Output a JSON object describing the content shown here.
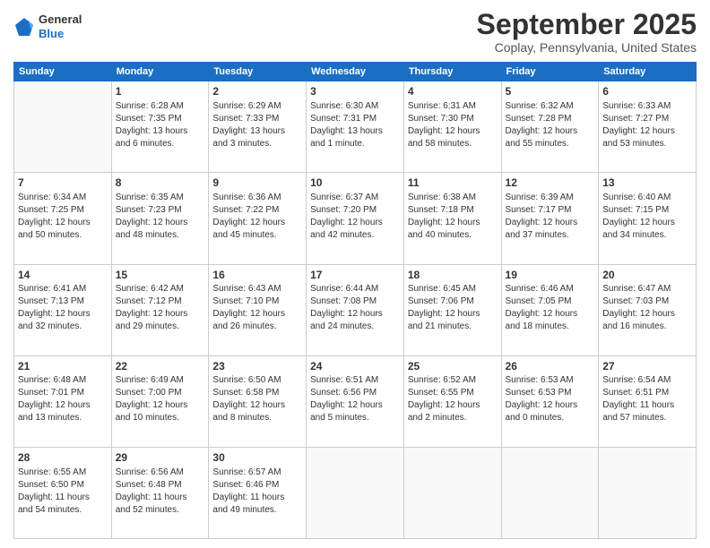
{
  "header": {
    "logo": {
      "general": "General",
      "blue": "Blue"
    },
    "title": "September 2025",
    "location": "Coplay, Pennsylvania, United States"
  },
  "calendar": {
    "headers": [
      "Sunday",
      "Monday",
      "Tuesday",
      "Wednesday",
      "Thursday",
      "Friday",
      "Saturday"
    ],
    "weeks": [
      [
        {
          "day": "",
          "data": ""
        },
        {
          "day": "1",
          "data": "Sunrise: 6:28 AM\nSunset: 7:35 PM\nDaylight: 13 hours\nand 6 minutes."
        },
        {
          "day": "2",
          "data": "Sunrise: 6:29 AM\nSunset: 7:33 PM\nDaylight: 13 hours\nand 3 minutes."
        },
        {
          "day": "3",
          "data": "Sunrise: 6:30 AM\nSunset: 7:31 PM\nDaylight: 13 hours\nand 1 minute."
        },
        {
          "day": "4",
          "data": "Sunrise: 6:31 AM\nSunset: 7:30 PM\nDaylight: 12 hours\nand 58 minutes."
        },
        {
          "day": "5",
          "data": "Sunrise: 6:32 AM\nSunset: 7:28 PM\nDaylight: 12 hours\nand 55 minutes."
        },
        {
          "day": "6",
          "data": "Sunrise: 6:33 AM\nSunset: 7:27 PM\nDaylight: 12 hours\nand 53 minutes."
        }
      ],
      [
        {
          "day": "7",
          "data": "Sunrise: 6:34 AM\nSunset: 7:25 PM\nDaylight: 12 hours\nand 50 minutes."
        },
        {
          "day": "8",
          "data": "Sunrise: 6:35 AM\nSunset: 7:23 PM\nDaylight: 12 hours\nand 48 minutes."
        },
        {
          "day": "9",
          "data": "Sunrise: 6:36 AM\nSunset: 7:22 PM\nDaylight: 12 hours\nand 45 minutes."
        },
        {
          "day": "10",
          "data": "Sunrise: 6:37 AM\nSunset: 7:20 PM\nDaylight: 12 hours\nand 42 minutes."
        },
        {
          "day": "11",
          "data": "Sunrise: 6:38 AM\nSunset: 7:18 PM\nDaylight: 12 hours\nand 40 minutes."
        },
        {
          "day": "12",
          "data": "Sunrise: 6:39 AM\nSunset: 7:17 PM\nDaylight: 12 hours\nand 37 minutes."
        },
        {
          "day": "13",
          "data": "Sunrise: 6:40 AM\nSunset: 7:15 PM\nDaylight: 12 hours\nand 34 minutes."
        }
      ],
      [
        {
          "day": "14",
          "data": "Sunrise: 6:41 AM\nSunset: 7:13 PM\nDaylight: 12 hours\nand 32 minutes."
        },
        {
          "day": "15",
          "data": "Sunrise: 6:42 AM\nSunset: 7:12 PM\nDaylight: 12 hours\nand 29 minutes."
        },
        {
          "day": "16",
          "data": "Sunrise: 6:43 AM\nSunset: 7:10 PM\nDaylight: 12 hours\nand 26 minutes."
        },
        {
          "day": "17",
          "data": "Sunrise: 6:44 AM\nSunset: 7:08 PM\nDaylight: 12 hours\nand 24 minutes."
        },
        {
          "day": "18",
          "data": "Sunrise: 6:45 AM\nSunset: 7:06 PM\nDaylight: 12 hours\nand 21 minutes."
        },
        {
          "day": "19",
          "data": "Sunrise: 6:46 AM\nSunset: 7:05 PM\nDaylight: 12 hours\nand 18 minutes."
        },
        {
          "day": "20",
          "data": "Sunrise: 6:47 AM\nSunset: 7:03 PM\nDaylight: 12 hours\nand 16 minutes."
        }
      ],
      [
        {
          "day": "21",
          "data": "Sunrise: 6:48 AM\nSunset: 7:01 PM\nDaylight: 12 hours\nand 13 minutes."
        },
        {
          "day": "22",
          "data": "Sunrise: 6:49 AM\nSunset: 7:00 PM\nDaylight: 12 hours\nand 10 minutes."
        },
        {
          "day": "23",
          "data": "Sunrise: 6:50 AM\nSunset: 6:58 PM\nDaylight: 12 hours\nand 8 minutes."
        },
        {
          "day": "24",
          "data": "Sunrise: 6:51 AM\nSunset: 6:56 PM\nDaylight: 12 hours\nand 5 minutes."
        },
        {
          "day": "25",
          "data": "Sunrise: 6:52 AM\nSunset: 6:55 PM\nDaylight: 12 hours\nand 2 minutes."
        },
        {
          "day": "26",
          "data": "Sunrise: 6:53 AM\nSunset: 6:53 PM\nDaylight: 12 hours\nand 0 minutes."
        },
        {
          "day": "27",
          "data": "Sunrise: 6:54 AM\nSunset: 6:51 PM\nDaylight: 11 hours\nand 57 minutes."
        }
      ],
      [
        {
          "day": "28",
          "data": "Sunrise: 6:55 AM\nSunset: 6:50 PM\nDaylight: 11 hours\nand 54 minutes."
        },
        {
          "day": "29",
          "data": "Sunrise: 6:56 AM\nSunset: 6:48 PM\nDaylight: 11 hours\nand 52 minutes."
        },
        {
          "day": "30",
          "data": "Sunrise: 6:57 AM\nSunset: 6:46 PM\nDaylight: 11 hours\nand 49 minutes."
        },
        {
          "day": "",
          "data": ""
        },
        {
          "day": "",
          "data": ""
        },
        {
          "day": "",
          "data": ""
        },
        {
          "day": "",
          "data": ""
        }
      ]
    ]
  }
}
